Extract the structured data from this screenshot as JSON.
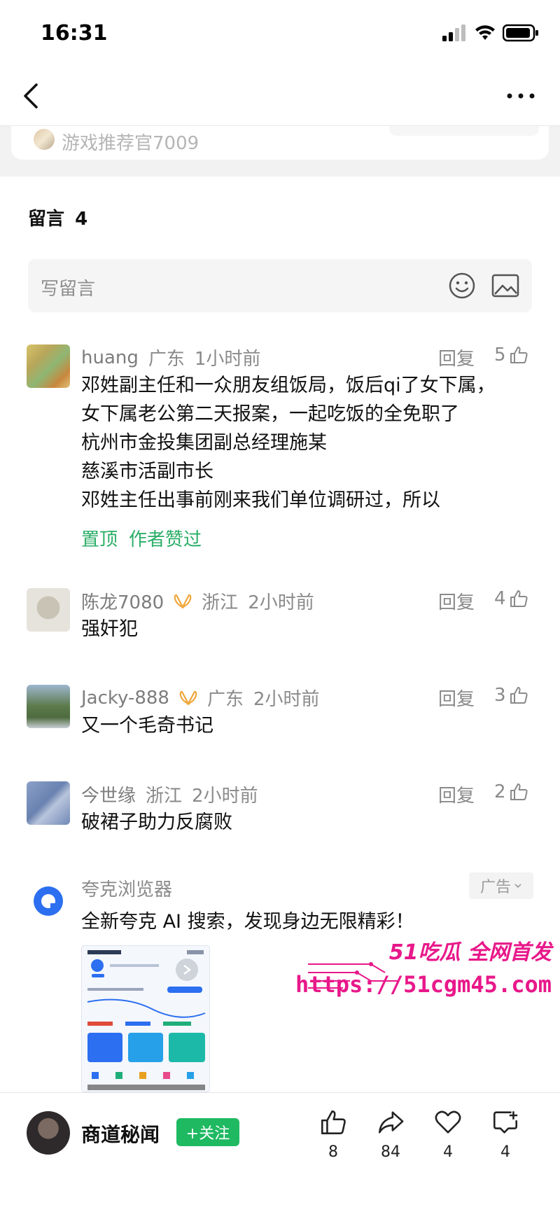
{
  "status_bar": {
    "time": "16:31"
  },
  "previous_card": {
    "author": "游戏推荐官7009"
  },
  "comments_section": {
    "title": "留言",
    "count": "4",
    "input_placeholder": "写留言"
  },
  "comments": [
    {
      "name": "huang",
      "location": "广东",
      "time": "1小时前",
      "reply_label": "回复",
      "likes": "5",
      "lines": [
        "邓姓副主任和一众朋友组饭局，饭后qi了女下属，",
        "女下属老公第二天报案，一起吃饭的全免职了",
        "杭州市金投集团副总经理施某",
        "慈溪市活副市长",
        "邓姓主任出事前刚来我们单位调研过，所以"
      ],
      "tags": [
        "置顶",
        "作者赞过"
      ]
    },
    {
      "name": "陈龙7080",
      "location": "浙江",
      "time": "2小时前",
      "reply_label": "回复",
      "likes": "4",
      "lines": [
        "强奸犯"
      ]
    },
    {
      "name": "Jacky-888",
      "location": "广东",
      "time": "2小时前",
      "reply_label": "回复",
      "likes": "3",
      "lines": [
        "又一个毛奇书记"
      ]
    },
    {
      "name": "今世缘",
      "location": "浙江",
      "time": "2小时前",
      "reply_label": "回复",
      "likes": "2",
      "lines": [
        "破裙子助力反腐败"
      ]
    }
  ],
  "ad": {
    "name": "夸克浏览器",
    "tag": "广告",
    "text": "全新夸克 AI 搜索，发现身边无限精彩！"
  },
  "watermark": {
    "top": "51吃瓜 全网首发",
    "url": "https://51cgm45.com"
  },
  "bottom_bar": {
    "author": "商道秘闻",
    "follow_label": "+关注",
    "like_count": "8",
    "share_count": "84",
    "favorite_count": "4",
    "comment_count": "4"
  },
  "colors": {
    "accent_green": "#1fb962",
    "tag_green": "#2aae67",
    "watermark_pink": "#e8188a"
  }
}
